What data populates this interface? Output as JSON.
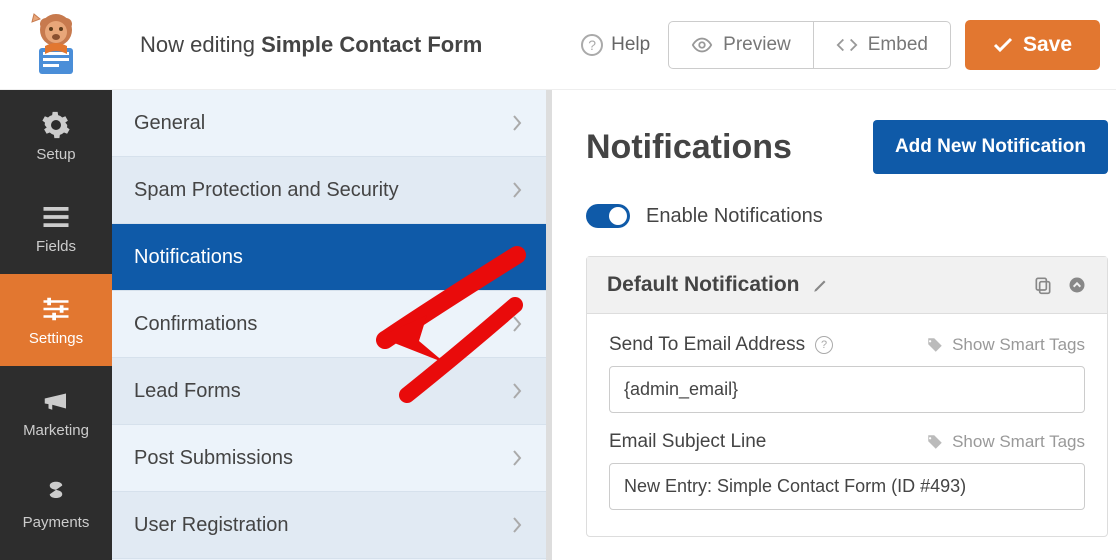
{
  "header": {
    "editing_prefix": "Now editing ",
    "editing_title": "Simple Contact Form",
    "help": "Help",
    "preview": "Preview",
    "embed": "Embed",
    "save": "Save"
  },
  "nav": {
    "items": [
      {
        "label": "Setup"
      },
      {
        "label": "Fields"
      },
      {
        "label": "Settings"
      },
      {
        "label": "Marketing"
      },
      {
        "label": "Payments"
      }
    ]
  },
  "settings_list": {
    "items": [
      {
        "label": "General"
      },
      {
        "label": "Spam Protection and Security"
      },
      {
        "label": "Notifications"
      },
      {
        "label": "Confirmations"
      },
      {
        "label": "Lead Forms"
      },
      {
        "label": "Post Submissions"
      },
      {
        "label": "User Registration"
      }
    ],
    "active_index": 2
  },
  "main": {
    "title": "Notifications",
    "add_button": "Add New Notification",
    "enable_label": "Enable Notifications",
    "enable_on": true,
    "panel_title": "Default Notification",
    "fields": {
      "send_to": {
        "label": "Send To Email Address",
        "value": "{admin_email}",
        "smart": "Show Smart Tags"
      },
      "subject": {
        "label": "Email Subject Line",
        "value": "New Entry: Simple Contact Form (ID #493)",
        "smart": "Show Smart Tags"
      }
    }
  },
  "colors": {
    "accent": "#E27730",
    "primary": "#0f5aa8"
  }
}
